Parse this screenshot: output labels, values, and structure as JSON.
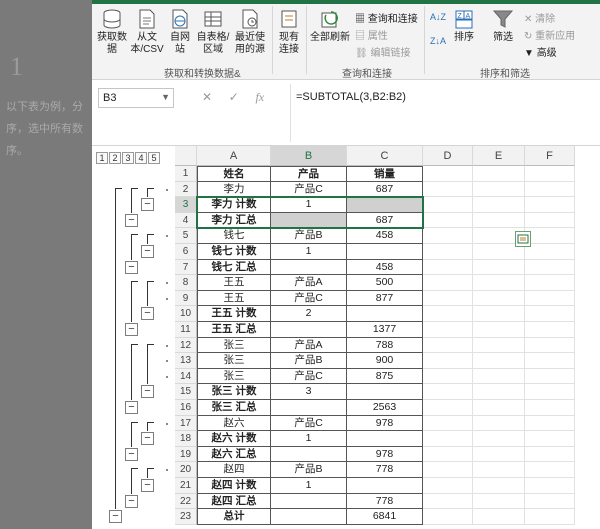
{
  "background": {
    "big_number": "1",
    "lines": [
      "以下表为例，分",
      "序，选中所有数",
      "序。"
    ]
  },
  "ribbon": {
    "get_data": "获取数据",
    "from_text": "从文本/CSV",
    "from_web": "自网站",
    "from_table": "自表格/区域",
    "recent_sources": "最近使用的源",
    "existing_conn": "现有连接",
    "refresh_all": "全部刷新",
    "queries_conn": "查询和连接",
    "properties": "属性",
    "edit_links": "编辑链接",
    "sort_az": "A↓Z",
    "sort_za": "Z↓A",
    "sort": "排序",
    "filter": "筛选",
    "clear": "清除",
    "reapply": "重新应用",
    "advanced": "高级",
    "group_get_transform": "获取和转换数据&",
    "group_queries": "查询和连接",
    "group_sort_filter": "排序和筛选"
  },
  "formula_bar": {
    "name_box": "B3",
    "formula": "=SUBTOTAL(3,B2:B2)"
  },
  "outline_levels": [
    "1",
    "2",
    "3",
    "4",
    "5"
  ],
  "columns": [
    "A",
    "B",
    "C",
    "D",
    "E",
    "F"
  ],
  "rows": [
    {
      "n": "1",
      "a": "姓名",
      "b": "产品",
      "c": "销量",
      "bold": true
    },
    {
      "n": "2",
      "a": "李力",
      "b": "产品C",
      "c": "687",
      "bold": false
    },
    {
      "n": "3",
      "a": "李力 计数",
      "b": "1",
      "c": "",
      "bold": true
    },
    {
      "n": "4",
      "a": "李力 汇总",
      "b": "",
      "c": "687",
      "bold": true
    },
    {
      "n": "5",
      "a": "钱七",
      "b": "产品B",
      "c": "458",
      "bold": false
    },
    {
      "n": "6",
      "a": "钱七 计数",
      "b": "1",
      "c": "",
      "bold": true
    },
    {
      "n": "7",
      "a": "钱七 汇总",
      "b": "",
      "c": "458",
      "bold": true
    },
    {
      "n": "8",
      "a": "王五",
      "b": "产品A",
      "c": "500",
      "bold": false
    },
    {
      "n": "9",
      "a": "王五",
      "b": "产品C",
      "c": "877",
      "bold": false
    },
    {
      "n": "10",
      "a": "王五 计数",
      "b": "2",
      "c": "",
      "bold": true
    },
    {
      "n": "11",
      "a": "王五 汇总",
      "b": "",
      "c": "1377",
      "bold": true
    },
    {
      "n": "12",
      "a": "张三",
      "b": "产品A",
      "c": "788",
      "bold": false
    },
    {
      "n": "13",
      "a": "张三",
      "b": "产品B",
      "c": "900",
      "bold": false
    },
    {
      "n": "14",
      "a": "张三",
      "b": "产品C",
      "c": "875",
      "bold": false
    },
    {
      "n": "15",
      "a": "张三 计数",
      "b": "3",
      "c": "",
      "bold": true
    },
    {
      "n": "16",
      "a": "张三 汇总",
      "b": "",
      "c": "2563",
      "bold": true
    },
    {
      "n": "17",
      "a": "赵六",
      "b": "产品C",
      "c": "978",
      "bold": false
    },
    {
      "n": "18",
      "a": "赵六 计数",
      "b": "1",
      "c": "",
      "bold": true
    },
    {
      "n": "19",
      "a": "赵六 汇总",
      "b": "",
      "c": "978",
      "bold": true
    },
    {
      "n": "20",
      "a": "赵四",
      "b": "产品B",
      "c": "778",
      "bold": false
    },
    {
      "n": "21",
      "a": "赵四 计数",
      "b": "1",
      "c": "",
      "bold": true
    },
    {
      "n": "22",
      "a": "赵四 汇总",
      "b": "",
      "c": "778",
      "bold": true
    },
    {
      "n": "23",
      "a": "总计",
      "b": "",
      "c": "6841",
      "bold": true
    }
  ],
  "colors": {
    "accent": "#217346"
  }
}
